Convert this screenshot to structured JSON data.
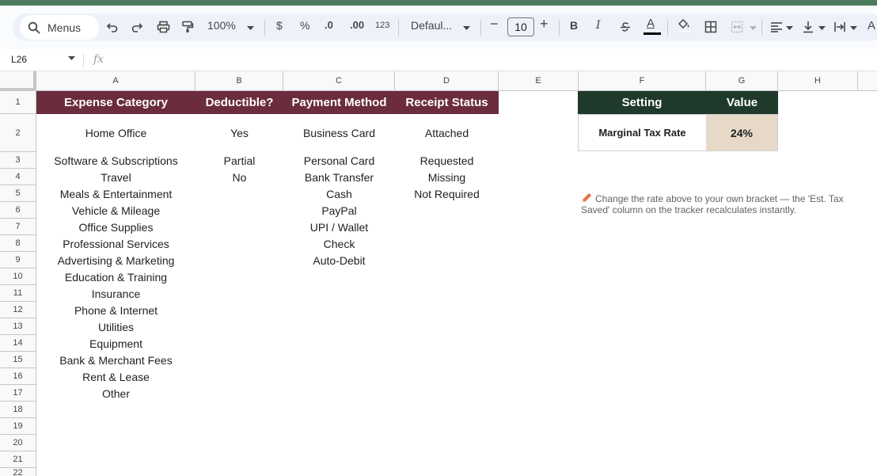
{
  "toolbar": {
    "search_label": "Menus",
    "zoom": "100%",
    "currency_symbol": "$",
    "percent_symbol": "%",
    "decrease_decimal": ".0",
    "increase_decimal": ".00",
    "more_formats": "123",
    "font_family": "Defaul...",
    "font_size": "10",
    "minus": "−",
    "plus": "+",
    "bold": "B",
    "italic": "I",
    "text_color_letter": "A",
    "wrap_letter": "A"
  },
  "formula_bar": {
    "cell_ref": "L26",
    "fx_label": "fx"
  },
  "columns": [
    "A",
    "B",
    "C",
    "D",
    "E",
    "F",
    "G",
    "H"
  ],
  "rows": [
    "1",
    "2",
    "3",
    "4",
    "5",
    "6",
    "7",
    "8",
    "9",
    "10",
    "11",
    "12",
    "13",
    "14",
    "15",
    "16",
    "17",
    "18",
    "19",
    "20",
    "21",
    "22"
  ],
  "headers": {
    "expense_category": "Expense Category",
    "deductible": "Deductible?",
    "payment_method": "Payment Method",
    "receipt_status": "Receipt Status",
    "setting": "Setting",
    "value": "Value"
  },
  "expense_categories": [
    "Home Office",
    "Software & Subscriptions",
    "Travel",
    "Meals & Entertainment",
    "Vehicle & Mileage",
    "Office Supplies",
    "Professional Services",
    "Advertising & Marketing",
    "Education & Training",
    "Insurance",
    "Phone & Internet",
    "Utilities",
    "Equipment",
    "Bank & Merchant Fees",
    "Rent & Lease",
    "Other"
  ],
  "deductible_options": [
    "Yes",
    "Partial",
    "No"
  ],
  "payment_methods": [
    "Business Card",
    "Personal Card",
    "Bank Transfer",
    "Cash",
    "PayPal",
    "UPI / Wallet",
    "Check",
    "Auto-Debit"
  ],
  "receipt_statuses": [
    "Attached",
    "Requested",
    "Missing",
    "Not Required"
  ],
  "settings": {
    "marginal_tax_label": "Marginal Tax Rate",
    "marginal_tax_value": "24%"
  },
  "note": {
    "icon": "pencil-icon",
    "text": "Change the rate above to your own bracket — the 'Est. Tax Saved' column on the tracker recalculates instantly."
  },
  "colors": {
    "maroon_header": "#6b2c3e",
    "green_header": "#1f3a2b",
    "value_fill": "#e6d9c8"
  }
}
